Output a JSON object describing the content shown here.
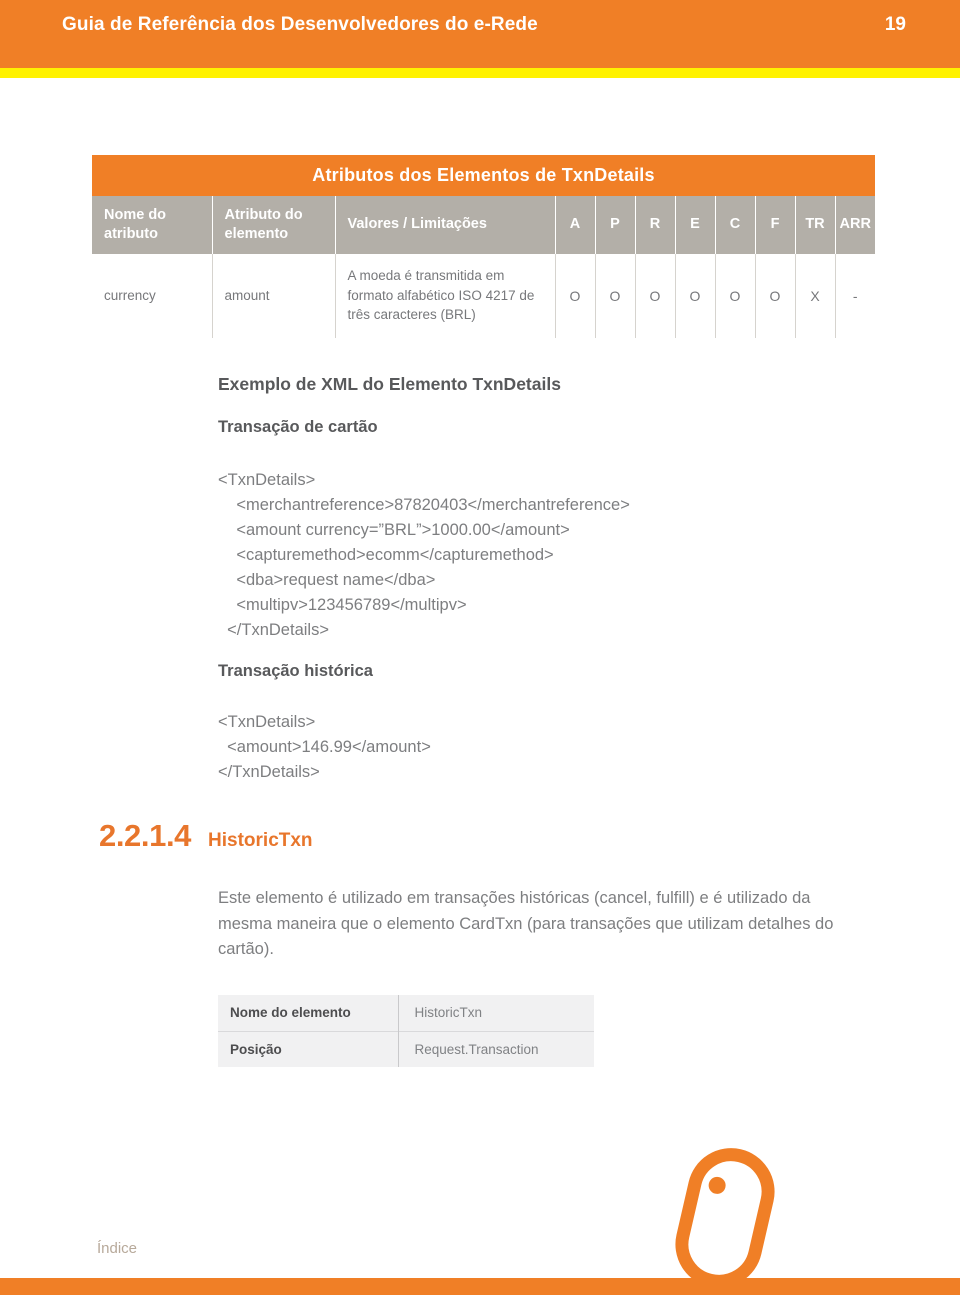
{
  "header": {
    "title": "Guia de Referência dos Desenvolvedores do e-Rede",
    "page_number": "19",
    "bar_color": "#F07F26",
    "rule_color": "#FFF200"
  },
  "attributes_table": {
    "caption": "Atributos dos Elementos de TxnDetails",
    "columns": [
      "Nome do atributo",
      "Atributo do elemento",
      "Valores / Limitações",
      "A",
      "P",
      "R",
      "E",
      "C",
      "F",
      "TR",
      "ARR"
    ],
    "rows": [
      {
        "nome_do_atributo": "currency",
        "atributo_do_elemento": "amount",
        "valores_limitacoes": "A moeda é transmitida em formato alfabético ISO 4217 de três caracteres (BRL)",
        "A": "O",
        "P": "O",
        "R": "O",
        "E": "O",
        "C": "O",
        "F": "O",
        "TR": "X",
        "ARR": "-"
      }
    ]
  },
  "body": {
    "example_heading": "Exemplo de XML do Elemento TxnDetails",
    "card_subheading": "Transação de cartão",
    "card_code": "<TxnDetails>\n    <merchantreference>87820403</merchantreference>\n    <amount currency=”BRL”>1000.00</amount>\n    <capturemethod>ecomm</capturemethod>\n    <dba>request name</dba>\n    <multipv>123456789</multipv>\n  </TxnDetails>",
    "historic_subheading": "Transação histórica",
    "historic_code": "<TxnDetails>\n  <amount>146.99</amount>\n</TxnDetails>"
  },
  "section": {
    "number": "2.2.1.4",
    "name": "HistoricTxn",
    "accent_color": "#E8762C",
    "paragraph": "Este elemento é utilizado em transações históricas (cancel, fulfill) e é utilizado da mesma maneira que o elemento CardTxn (para transações que utilizam detalhes do cartão)."
  },
  "element_table": {
    "rows": [
      {
        "key": "Nome do elemento",
        "value": "HistoricTxn"
      },
      {
        "key": "Posição",
        "value": "Request.Transaction"
      }
    ]
  },
  "footer": {
    "index_link": "Índice",
    "bar_color": "#F07F26",
    "logo_name": "erede-mouse-logo"
  }
}
